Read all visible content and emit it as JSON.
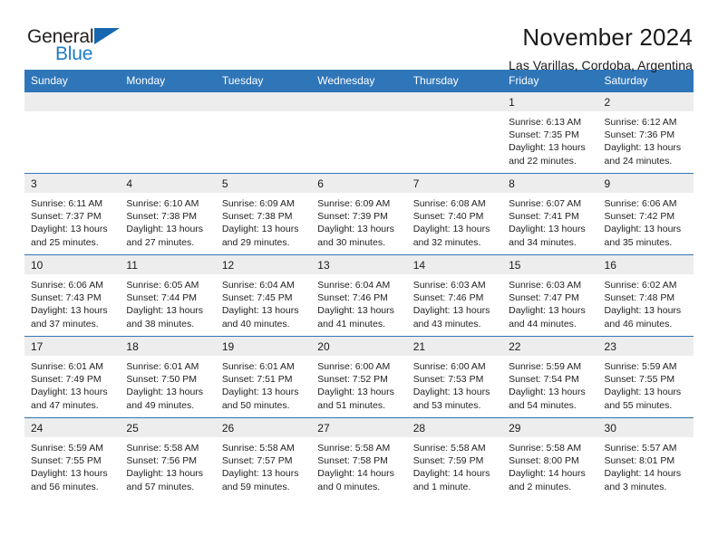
{
  "brand": {
    "name_part1": "General",
    "name_part2": "Blue",
    "flag_icon": "triangle-flag-icon",
    "accent_color": "#1d7cc4"
  },
  "header": {
    "title": "November 2024",
    "subtitle": "Las Varillas, Cordoba, Argentina"
  },
  "theme": {
    "header_blue": "#2f76b9",
    "daynum_gray": "#ededed",
    "text_color": "#1a1a1a"
  },
  "calendar": {
    "weekday_headers": [
      "Sunday",
      "Monday",
      "Tuesday",
      "Wednesday",
      "Thursday",
      "Friday",
      "Saturday"
    ],
    "weeks": [
      [
        {
          "day": "",
          "empty": true
        },
        {
          "day": "",
          "empty": true
        },
        {
          "day": "",
          "empty": true
        },
        {
          "day": "",
          "empty": true
        },
        {
          "day": "",
          "empty": true
        },
        {
          "day": "1",
          "sunrise": "Sunrise: 6:13 AM",
          "sunset": "Sunset: 7:35 PM",
          "daylight1": "Daylight: 13 hours",
          "daylight2": "and 22 minutes."
        },
        {
          "day": "2",
          "sunrise": "Sunrise: 6:12 AM",
          "sunset": "Sunset: 7:36 PM",
          "daylight1": "Daylight: 13 hours",
          "daylight2": "and 24 minutes."
        }
      ],
      [
        {
          "day": "3",
          "sunrise": "Sunrise: 6:11 AM",
          "sunset": "Sunset: 7:37 PM",
          "daylight1": "Daylight: 13 hours",
          "daylight2": "and 25 minutes."
        },
        {
          "day": "4",
          "sunrise": "Sunrise: 6:10 AM",
          "sunset": "Sunset: 7:38 PM",
          "daylight1": "Daylight: 13 hours",
          "daylight2": "and 27 minutes."
        },
        {
          "day": "5",
          "sunrise": "Sunrise: 6:09 AM",
          "sunset": "Sunset: 7:38 PM",
          "daylight1": "Daylight: 13 hours",
          "daylight2": "and 29 minutes."
        },
        {
          "day": "6",
          "sunrise": "Sunrise: 6:09 AM",
          "sunset": "Sunset: 7:39 PM",
          "daylight1": "Daylight: 13 hours",
          "daylight2": "and 30 minutes."
        },
        {
          "day": "7",
          "sunrise": "Sunrise: 6:08 AM",
          "sunset": "Sunset: 7:40 PM",
          "daylight1": "Daylight: 13 hours",
          "daylight2": "and 32 minutes."
        },
        {
          "day": "8",
          "sunrise": "Sunrise: 6:07 AM",
          "sunset": "Sunset: 7:41 PM",
          "daylight1": "Daylight: 13 hours",
          "daylight2": "and 34 minutes."
        },
        {
          "day": "9",
          "sunrise": "Sunrise: 6:06 AM",
          "sunset": "Sunset: 7:42 PM",
          "daylight1": "Daylight: 13 hours",
          "daylight2": "and 35 minutes."
        }
      ],
      [
        {
          "day": "10",
          "sunrise": "Sunrise: 6:06 AM",
          "sunset": "Sunset: 7:43 PM",
          "daylight1": "Daylight: 13 hours",
          "daylight2": "and 37 minutes."
        },
        {
          "day": "11",
          "sunrise": "Sunrise: 6:05 AM",
          "sunset": "Sunset: 7:44 PM",
          "daylight1": "Daylight: 13 hours",
          "daylight2": "and 38 minutes."
        },
        {
          "day": "12",
          "sunrise": "Sunrise: 6:04 AM",
          "sunset": "Sunset: 7:45 PM",
          "daylight1": "Daylight: 13 hours",
          "daylight2": "and 40 minutes."
        },
        {
          "day": "13",
          "sunrise": "Sunrise: 6:04 AM",
          "sunset": "Sunset: 7:46 PM",
          "daylight1": "Daylight: 13 hours",
          "daylight2": "and 41 minutes."
        },
        {
          "day": "14",
          "sunrise": "Sunrise: 6:03 AM",
          "sunset": "Sunset: 7:46 PM",
          "daylight1": "Daylight: 13 hours",
          "daylight2": "and 43 minutes."
        },
        {
          "day": "15",
          "sunrise": "Sunrise: 6:03 AM",
          "sunset": "Sunset: 7:47 PM",
          "daylight1": "Daylight: 13 hours",
          "daylight2": "and 44 minutes."
        },
        {
          "day": "16",
          "sunrise": "Sunrise: 6:02 AM",
          "sunset": "Sunset: 7:48 PM",
          "daylight1": "Daylight: 13 hours",
          "daylight2": "and 46 minutes."
        }
      ],
      [
        {
          "day": "17",
          "sunrise": "Sunrise: 6:01 AM",
          "sunset": "Sunset: 7:49 PM",
          "daylight1": "Daylight: 13 hours",
          "daylight2": "and 47 minutes."
        },
        {
          "day": "18",
          "sunrise": "Sunrise: 6:01 AM",
          "sunset": "Sunset: 7:50 PM",
          "daylight1": "Daylight: 13 hours",
          "daylight2": "and 49 minutes."
        },
        {
          "day": "19",
          "sunrise": "Sunrise: 6:01 AM",
          "sunset": "Sunset: 7:51 PM",
          "daylight1": "Daylight: 13 hours",
          "daylight2": "and 50 minutes."
        },
        {
          "day": "20",
          "sunrise": "Sunrise: 6:00 AM",
          "sunset": "Sunset: 7:52 PM",
          "daylight1": "Daylight: 13 hours",
          "daylight2": "and 51 minutes."
        },
        {
          "day": "21",
          "sunrise": "Sunrise: 6:00 AM",
          "sunset": "Sunset: 7:53 PM",
          "daylight1": "Daylight: 13 hours",
          "daylight2": "and 53 minutes."
        },
        {
          "day": "22",
          "sunrise": "Sunrise: 5:59 AM",
          "sunset": "Sunset: 7:54 PM",
          "daylight1": "Daylight: 13 hours",
          "daylight2": "and 54 minutes."
        },
        {
          "day": "23",
          "sunrise": "Sunrise: 5:59 AM",
          "sunset": "Sunset: 7:55 PM",
          "daylight1": "Daylight: 13 hours",
          "daylight2": "and 55 minutes."
        }
      ],
      [
        {
          "day": "24",
          "sunrise": "Sunrise: 5:59 AM",
          "sunset": "Sunset: 7:55 PM",
          "daylight1": "Daylight: 13 hours",
          "daylight2": "and 56 minutes."
        },
        {
          "day": "25",
          "sunrise": "Sunrise: 5:58 AM",
          "sunset": "Sunset: 7:56 PM",
          "daylight1": "Daylight: 13 hours",
          "daylight2": "and 57 minutes."
        },
        {
          "day": "26",
          "sunrise": "Sunrise: 5:58 AM",
          "sunset": "Sunset: 7:57 PM",
          "daylight1": "Daylight: 13 hours",
          "daylight2": "and 59 minutes."
        },
        {
          "day": "27",
          "sunrise": "Sunrise: 5:58 AM",
          "sunset": "Sunset: 7:58 PM",
          "daylight1": "Daylight: 14 hours",
          "daylight2": "and 0 minutes."
        },
        {
          "day": "28",
          "sunrise": "Sunrise: 5:58 AM",
          "sunset": "Sunset: 7:59 PM",
          "daylight1": "Daylight: 14 hours",
          "daylight2": "and 1 minute."
        },
        {
          "day": "29",
          "sunrise": "Sunrise: 5:58 AM",
          "sunset": "Sunset: 8:00 PM",
          "daylight1": "Daylight: 14 hours",
          "daylight2": "and 2 minutes."
        },
        {
          "day": "30",
          "sunrise": "Sunrise: 5:57 AM",
          "sunset": "Sunset: 8:01 PM",
          "daylight1": "Daylight: 14 hours",
          "daylight2": "and 3 minutes."
        }
      ]
    ]
  }
}
